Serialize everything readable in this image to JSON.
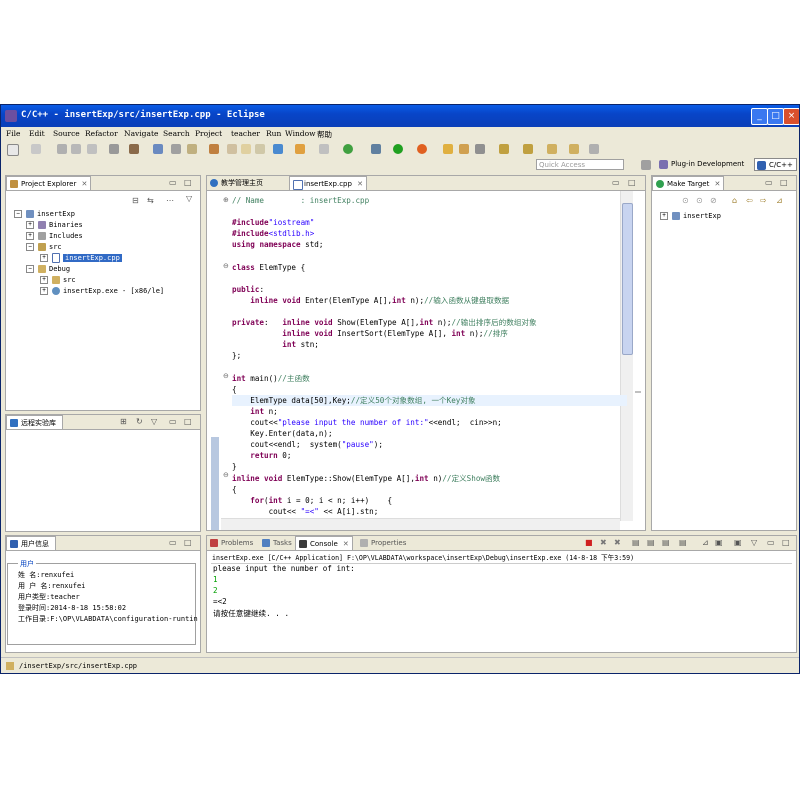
{
  "window": {
    "title": "C/C++ - insertExp/src/insertExp.cpp - Eclipse"
  },
  "menu": [
    "File",
    "Edit",
    "Source",
    "Refactor",
    "Navigate",
    "Search",
    "Project",
    "teacher",
    "Run",
    "Window",
    "帮助"
  ],
  "quick_access": {
    "placeholder": "Quick Access"
  },
  "perspectives": [
    {
      "label": "Plug-in Development"
    },
    {
      "label": "C/C++"
    }
  ],
  "project_explorer": {
    "tab": "Project Explorer",
    "items": [
      {
        "label": "insertExp",
        "level": 0,
        "expanded": true
      },
      {
        "label": "Binaries",
        "level": 1
      },
      {
        "label": "Includes",
        "level": 1
      },
      {
        "label": "src",
        "level": 1,
        "expanded": true
      },
      {
        "label": "insertExp.cpp",
        "level": 2,
        "selected": true
      },
      {
        "label": "Debug",
        "level": 1,
        "expanded": true
      },
      {
        "label": "src",
        "level": 2
      },
      {
        "label": "insertExp.exe - [x86/le]",
        "level": 2
      }
    ]
  },
  "remote_lab": {
    "tab": "远程实验库"
  },
  "user_info": {
    "tab": "用户信息",
    "group": "用户",
    "rows": [
      {
        "label": "姓  名:",
        "value": "renxufei"
      },
      {
        "label": "用 户 名:",
        "value": "renxufei"
      },
      {
        "label": "用户类型:",
        "value": "teacher"
      },
      {
        "label": "登录时间:",
        "value": "2014-8-18 15:58:02"
      },
      {
        "label": "工作目录:",
        "value": "F:\\OP\\VLABDATA\\configuration-runtin"
      }
    ]
  },
  "editor": {
    "tabs": [
      {
        "label": "教学管理主页"
      },
      {
        "label": "insertExp.cpp"
      }
    ],
    "lines": [
      {
        "t": "comment",
        "s": "// Name        : insertExp.cpp"
      },
      {
        "t": "blank",
        "s": ""
      },
      {
        "t": "include",
        "a": "#include",
        "b": "\"iostream\""
      },
      {
        "t": "include",
        "a": "#include",
        "b": "<stdlib.h>"
      },
      {
        "t": "using",
        "s": "using namespace std;"
      },
      {
        "t": "blank",
        "s": ""
      },
      {
        "t": "class",
        "s": "class ElemType {"
      },
      {
        "t": "blank",
        "s": ""
      },
      {
        "t": "public",
        "s": "public:"
      },
      {
        "t": "m1",
        "s": "    inline void Enter(ElemType A[],int n);//输入函数从键盘取数据"
      },
      {
        "t": "blank",
        "s": ""
      },
      {
        "t": "private",
        "s": "private:   inline void Show(ElemType A[],int n);//输出排序后的数组对象"
      },
      {
        "t": "m3",
        "s": "           inline void InsertSort(ElemType A[], int n);//排序"
      },
      {
        "t": "m4",
        "s": "           int stn;"
      },
      {
        "t": "plain",
        "s": "};"
      },
      {
        "t": "blank",
        "s": ""
      },
      {
        "t": "main",
        "s": "int main()//主函数"
      },
      {
        "t": "plain",
        "s": "{"
      },
      {
        "t": "hl",
        "s": "    ElemType data[50],Key;//定义50个对象数组, 一个Key对象"
      },
      {
        "t": "plain",
        "s": "    int n;"
      },
      {
        "t": "plain",
        "s": "    cout<<\"please input the number of int:\"<<endl;  cin>>n;"
      },
      {
        "t": "plain",
        "s": "    Key.Enter(data,n);"
      },
      {
        "t": "plain",
        "s": "    cout<<endl;  system(\"pause\");"
      },
      {
        "t": "plain",
        "s": "    return 0;"
      },
      {
        "t": "plain",
        "s": "}"
      },
      {
        "t": "show",
        "s": "inline void ElemType::Show(ElemType A[],int n)//定义Show函数"
      },
      {
        "t": "plain",
        "s": "{"
      },
      {
        "t": "plain",
        "s": "    for(int i = 0; i < n; i++)    {"
      },
      {
        "t": "plain",
        "s": "        cout<< \"=<\" << A[i].stn;"
      }
    ]
  },
  "make_target": {
    "tab": "Make Target",
    "items": [
      {
        "label": "insertExp"
      }
    ]
  },
  "bottom": {
    "tabs": [
      {
        "label": "Problems"
      },
      {
        "label": "Tasks"
      },
      {
        "label": "Console"
      },
      {
        "label": "Properties"
      }
    ],
    "console_header": "insertExp.exe [C/C++ Application] F:\\OP\\VLABDATA\\workspace\\insertExp\\Debug\\insertExp.exe (14-8-18 下午3:59)",
    "console_lines": [
      {
        "s": "please input the number of int:",
        "c": "#000000"
      },
      {
        "s": "1",
        "c": "#00a000"
      },
      {
        "s": "2",
        "c": "#00a000"
      },
      {
        "s": "=<2",
        "c": "#000000"
      },
      {
        "s": "请按任意键继续. . .",
        "c": "#000000"
      }
    ]
  },
  "status": {
    "path": "/insertExp/src/insertExp.cpp"
  }
}
